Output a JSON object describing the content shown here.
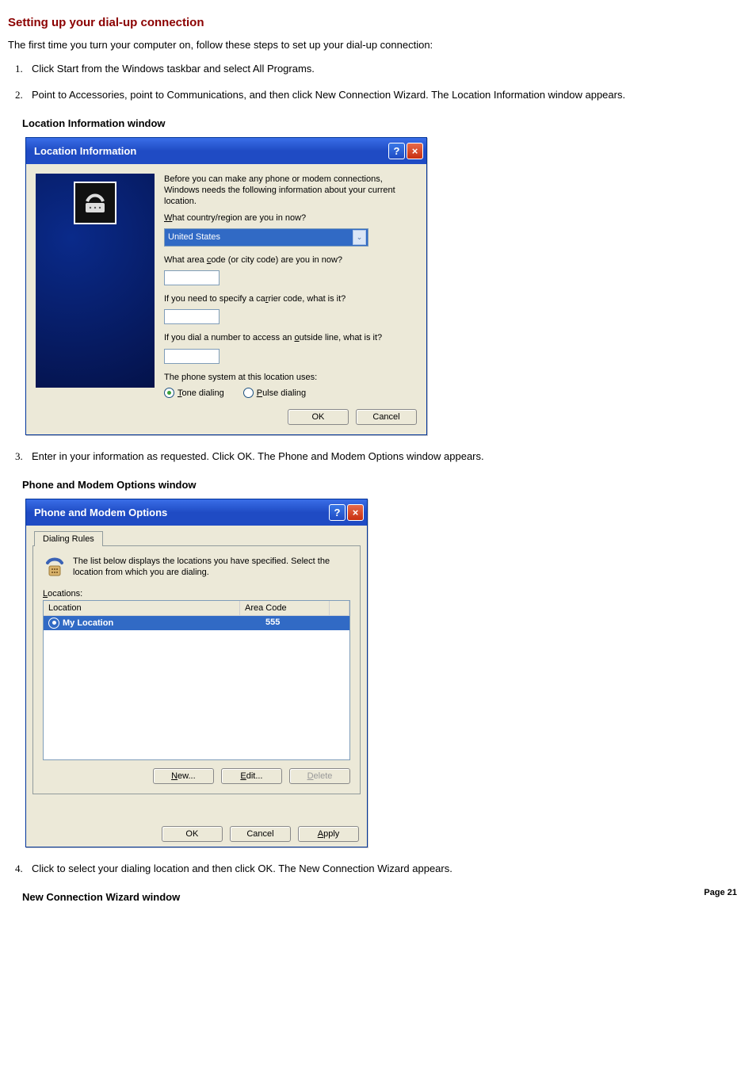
{
  "title": "Setting up your dial-up connection",
  "intro": "The first time you turn your computer on, follow these steps to set up your dial-up connection:",
  "steps": {
    "s1": "Click Start from the Windows taskbar and select All Programs.",
    "s2": "Point to Accessories, point to Communications, and then click New Connection Wizard. The Location Information window appears.",
    "s3": "Enter in your information as requested. Click OK. The Phone and Modem Options window appears.",
    "s4": "Click to select your dialing location and then click OK. The New Connection Wizard appears."
  },
  "caption1": "Location Information window",
  "caption2": "Phone and Modem Options window",
  "caption3": "New Connection Wizard window",
  "page_label": "Page 21",
  "win1": {
    "title": "Location Information",
    "intro": "Before you can make any phone or modem connections, Windows needs the following information about your current location.",
    "q_country_pre": "W",
    "q_country_post": "hat country/region are you in now?",
    "country_value": "United States",
    "q_area_pre": "What area ",
    "q_area_u": "c",
    "q_area_post": "ode (or city code) are you in now?",
    "q_carrier_pre": "If you need to specify a ca",
    "q_carrier_u": "r",
    "q_carrier_post": "rier code, what is it?",
    "q_outside_pre": "If you dial a number to access an ",
    "q_outside_u": "o",
    "q_outside_post": "utside line, what is it?",
    "phone_system": "The phone system at this location uses:",
    "tone_pre": "T",
    "tone_post": "one dialing",
    "pulse_pre": "P",
    "pulse_post": "ulse dialing",
    "ok": "OK",
    "cancel": "Cancel"
  },
  "win2": {
    "title": "Phone and Modem Options",
    "tab": "Dialing Rules",
    "desc": "The list below displays the locations you have specified. Select the location from which you are dialing.",
    "locations_pre": "L",
    "locations_post": "ocations:",
    "col_location": "Location",
    "col_area": "Area Code",
    "row_name": "My Location",
    "row_area": "555",
    "new_pre": "N",
    "new_post": "ew...",
    "edit_pre": "E",
    "edit_post": "dit...",
    "delete_pre": "D",
    "delete_post": "elete",
    "ok": "OK",
    "cancel": "Cancel",
    "apply_pre": "A",
    "apply_post": "pply"
  }
}
